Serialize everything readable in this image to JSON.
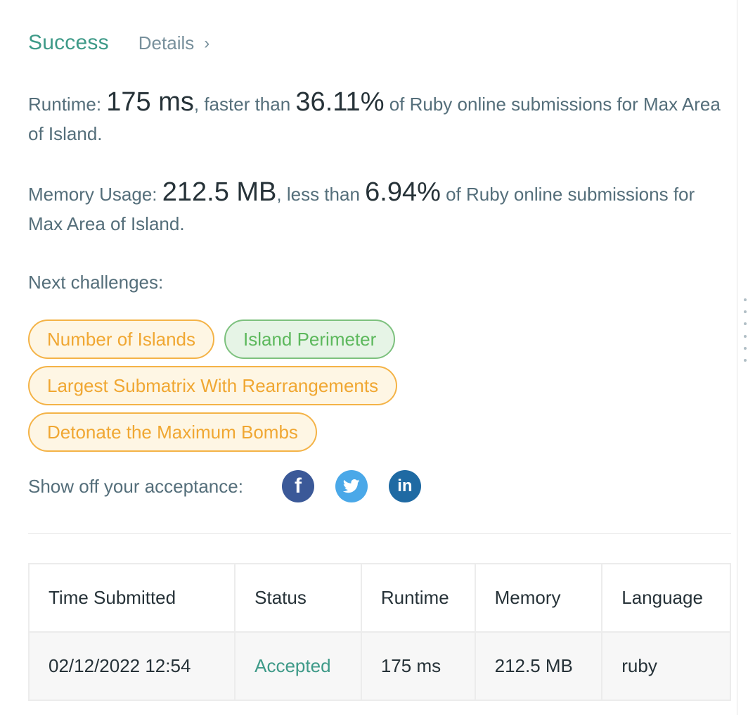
{
  "header": {
    "status": "Success",
    "details_label": "Details",
    "chevron": "›"
  },
  "runtime": {
    "prefix": "Runtime: ",
    "value": "175 ms",
    "middle": ", faster than ",
    "percent": "36.11%",
    "suffix": " of Ruby online submissions for Max Area of Island."
  },
  "memory": {
    "prefix": "Memory Usage: ",
    "value": "212.5 MB",
    "middle": ", less than ",
    "percent": "6.94%",
    "suffix": " of Ruby online submissions for Max Area of Island."
  },
  "next_challenges": {
    "label": "Next challenges:",
    "items": [
      {
        "label": "Number of Islands",
        "difficulty": "medium"
      },
      {
        "label": "Island Perimeter",
        "difficulty": "easy"
      },
      {
        "label": "Largest Submatrix With Rearrangements",
        "difficulty": "medium"
      },
      {
        "label": "Detonate the Maximum Bombs",
        "difficulty": "medium"
      }
    ]
  },
  "share": {
    "label": "Show off your acceptance:",
    "icons": [
      "facebook-icon",
      "twitter-icon",
      "linkedin-icon"
    ],
    "facebook_glyph": "f",
    "linkedin_glyph": "in"
  },
  "table": {
    "headers": [
      "Time Submitted",
      "Status",
      "Runtime",
      "Memory",
      "Language"
    ],
    "rows": [
      [
        "02/12/2022 12:54",
        "Accepted",
        "175 ms",
        "212.5 MB",
        "ruby"
      ]
    ]
  },
  "colors": {
    "success": "#3e9a88",
    "medium_tag_border": "#f4b347",
    "easy_tag_border": "#7dc17e",
    "facebook": "#3b5998",
    "twitter": "#4aa8e8",
    "linkedin": "#1f6aa3"
  }
}
